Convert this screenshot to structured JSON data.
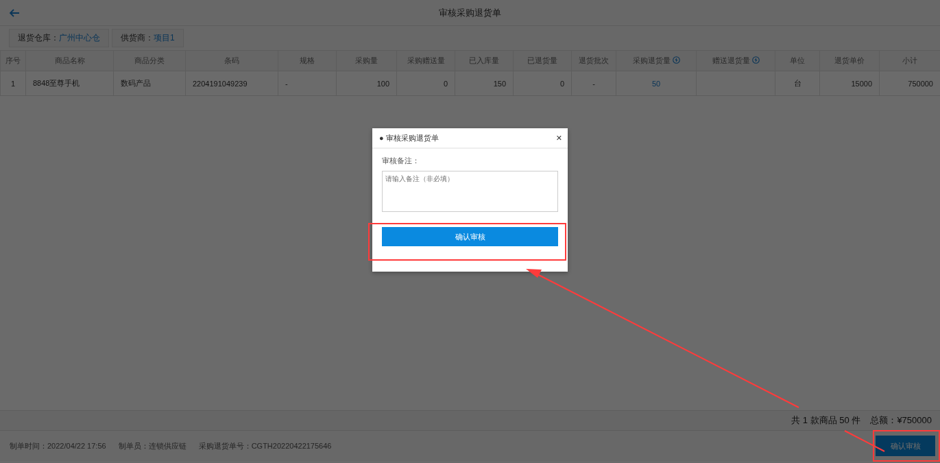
{
  "header": {
    "title": "审核采购退货单"
  },
  "filters": [
    {
      "label": "退货仓库：",
      "value": "广州中心仓"
    },
    {
      "label": "供货商：",
      "value": "项目1"
    }
  ],
  "table": {
    "columns": [
      {
        "label": "序号",
        "editable": false
      },
      {
        "label": "商品名称",
        "editable": false
      },
      {
        "label": "商品分类",
        "editable": false
      },
      {
        "label": "条码",
        "editable": false
      },
      {
        "label": "规格",
        "editable": false
      },
      {
        "label": "采购量",
        "editable": false
      },
      {
        "label": "采购赠送量",
        "editable": false
      },
      {
        "label": "已入库量",
        "editable": false
      },
      {
        "label": "已退货量",
        "editable": false
      },
      {
        "label": "退货批次",
        "editable": false
      },
      {
        "label": "采购退货量",
        "editable": true
      },
      {
        "label": "赠送退货量",
        "editable": true
      },
      {
        "label": "单位",
        "editable": false
      },
      {
        "label": "退货单价",
        "editable": false
      },
      {
        "label": "小计",
        "editable": false
      }
    ],
    "rows": [
      [
        "1",
        "8848至尊手机",
        "数码产品",
        "2204191049239",
        "-",
        "100",
        "0",
        "150",
        "0",
        "-",
        "50",
        "",
        "台",
        "15000",
        "750000"
      ]
    ]
  },
  "summary": {
    "count": "共 1 款商品 50 件",
    "total_label": "总额：",
    "total": "¥750000"
  },
  "footer": {
    "info": [
      "制单时间：2022/04/22 17:56",
      "制单员：连锁供应链",
      "采购退货单号：CGTH20220422175646"
    ],
    "button": "确认审核"
  },
  "dialog": {
    "bullet": "●",
    "title": "审核采购退货单",
    "close": "✕",
    "field_label": "审核备注：",
    "placeholder": "请输入备注（非必填）",
    "button": "确认审核"
  }
}
